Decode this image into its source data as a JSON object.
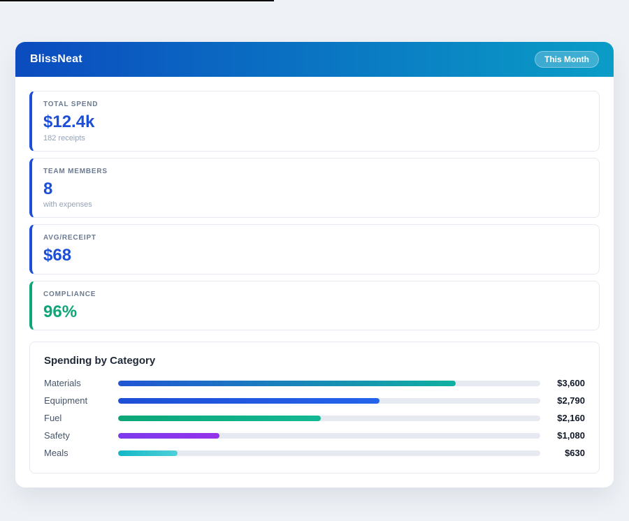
{
  "header": {
    "title": "BlissNeat",
    "badge": "This Month"
  },
  "colors": {
    "page_bg": "#eef1f6",
    "header_from": "#0b4bbf",
    "header_to": "#0a9dc6",
    "stat_blue": "#1d4ed8",
    "stat_green": "#0ca678",
    "track": "#e6eaf0"
  },
  "stats": [
    {
      "label": "TOTAL SPEND",
      "value": "$12.4k",
      "sub": "182 receipts",
      "accent": "#1d4ed8"
    },
    {
      "label": "TEAM MEMBERS",
      "value": "8",
      "sub": "with expenses",
      "accent": "#1d4ed8"
    },
    {
      "label": "AVG/RECEIPT",
      "value": "$68",
      "sub": "",
      "accent": "#1d4ed8"
    },
    {
      "label": "COMPLIANCE",
      "value": "96%",
      "sub": "",
      "accent": "#0ca678"
    }
  ],
  "chart_data": {
    "type": "bar",
    "orientation": "horizontal",
    "title": "Spending by Category",
    "categories": [
      "Materials",
      "Equipment",
      "Fuel",
      "Safety",
      "Meals"
    ],
    "values": [
      3600,
      2790,
      2160,
      1080,
      630
    ],
    "value_labels": [
      "$3,600",
      "$2,790",
      "$2,160",
      "$1,080",
      "$630"
    ],
    "max": 4500,
    "grid": false,
    "legend": "none",
    "bar_colors": [
      {
        "from": "#2155d4",
        "to": "#10b0a0"
      },
      {
        "from": "#1d4fd6",
        "to": "#2563eb"
      },
      {
        "from": "#0ca678",
        "to": "#13b893"
      },
      {
        "from": "#7c3aed",
        "to": "#9333ea"
      },
      {
        "from": "#14b8c6",
        "to": "#4dd0d9"
      }
    ]
  }
}
